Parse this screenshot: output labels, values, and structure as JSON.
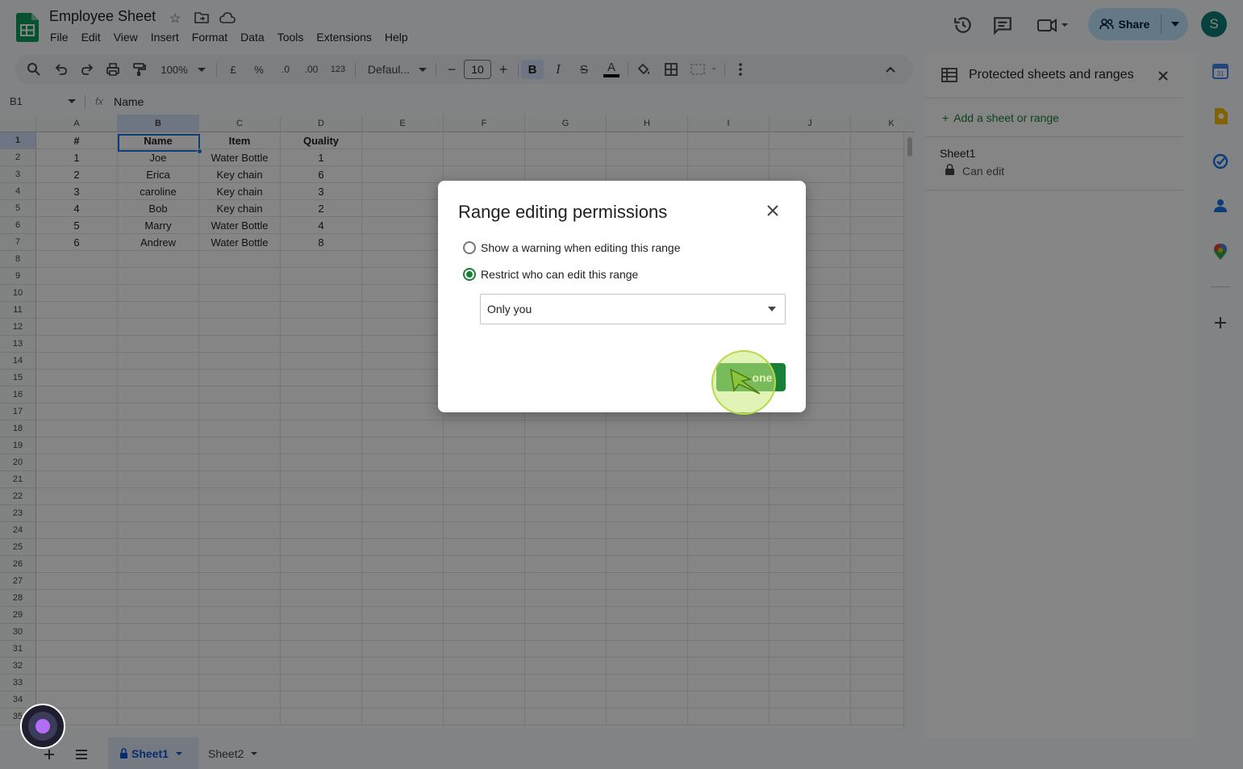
{
  "app": {
    "doc_title": "Employee Sheet",
    "menu": [
      "File",
      "Edit",
      "View",
      "Insert",
      "Format",
      "Data",
      "Tools",
      "Extensions",
      "Help"
    ],
    "share_label": "Share",
    "avatar_letter": "S"
  },
  "toolbar": {
    "zoom": "100%",
    "currency": "£",
    "percent": "%",
    "dec_decrease": ".0",
    "dec_increase": ".00",
    "number_format": "123",
    "font": "Defaul...",
    "font_size": "10",
    "bold": "B",
    "italic": "I",
    "strike": "S",
    "text_color": "A"
  },
  "formula_bar": {
    "cell_ref": "B1",
    "fx": "fx",
    "value": "Name"
  },
  "grid": {
    "columns": [
      "A",
      "B",
      "C",
      "D",
      "E",
      "F",
      "G",
      "H",
      "I",
      "J",
      "K"
    ],
    "row_count": 35,
    "rows": [
      [
        "#",
        "Name",
        "Item",
        "Quality"
      ],
      [
        "1",
        "Joe",
        "Water Bottle",
        "1"
      ],
      [
        "2",
        "Erica",
        "Key chain",
        "6"
      ],
      [
        "3",
        "caroline",
        "Key chain",
        "3"
      ],
      [
        "4",
        "Bob",
        "Key chain",
        "2"
      ],
      [
        "5",
        "Marry",
        "Water Bottle",
        "4"
      ],
      [
        "6",
        "Andrew",
        "Water Bottle",
        "8"
      ]
    ]
  },
  "side_panel": {
    "title": "Protected sheets and ranges",
    "add_label": "Add a sheet or range",
    "entry_sheet": "Sheet1",
    "entry_perm": "Can edit"
  },
  "sheets": {
    "tabs": [
      "Sheet1",
      "Sheet2"
    ],
    "active": "Sheet1"
  },
  "dialog": {
    "title": "Range editing permissions",
    "option_warning": "Show a warning when editing this range",
    "option_restrict": "Restrict who can edit this range",
    "selected_option": "restrict",
    "select_value": "Only you",
    "done_label": "Done",
    "done_visible_text": "one"
  },
  "colors": {
    "accent_green": "#188038",
    "share_bg": "#c2e7ff",
    "avatar_bg": "#0b7d76",
    "selection_blue": "#1a73e8"
  }
}
